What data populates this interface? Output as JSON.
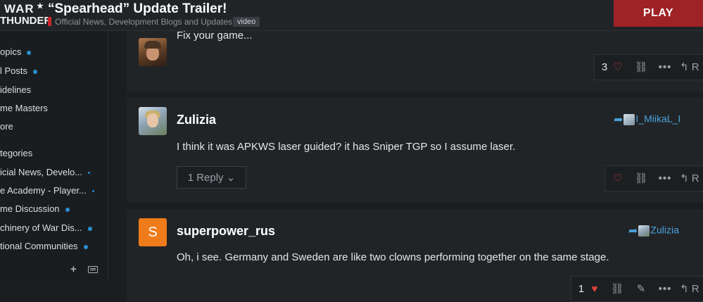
{
  "header": {
    "logo_line1": "WAR",
    "logo_line2": "THUNDER",
    "topic_title": "“Spearhead” Update Trailer!",
    "category": "Official News, Development Blogs and Updates",
    "tag": "video",
    "play_label": "PLAY"
  },
  "sidebar": {
    "items": [
      {
        "label": "opics",
        "dot": true
      },
      {
        "label": "l Posts",
        "dot": true
      },
      {
        "label": "idelines",
        "dot": false
      },
      {
        "label": "me Masters",
        "dot": false
      },
      {
        "label": "ore",
        "dot": false
      },
      {
        "label": "tegories",
        "dot": false
      },
      {
        "label": "icial News, Develo...",
        "dot": "small"
      },
      {
        "label": "e Academy - Player...",
        "dot": "small"
      },
      {
        "label": "me Discussion",
        "dot": true
      },
      {
        "label": "chinery of War Dis...",
        "dot": true
      },
      {
        "label": "tional Communities",
        "dot": true
      }
    ],
    "accent_color": "#2a8fd1"
  },
  "posts": [
    {
      "body": "Fix your game...",
      "likes": "3",
      "actions": [
        "heart-icon",
        "link-icon",
        "more-icon",
        "reply-icon"
      ],
      "reply_label": "R"
    },
    {
      "username": "Zulizia",
      "reply_to": "I_MiikaL_I",
      "body": "I think it was APKWS laser guided? it has Sniper TGP so I assume laser.",
      "replies_button": "1 Reply",
      "actions": [
        "heart-icon",
        "link-icon",
        "more-icon",
        "reply-icon"
      ],
      "reply_label": "R"
    },
    {
      "username": "superpower_rus",
      "avatar_letter": "S",
      "avatar_color": "#ef7b1a",
      "reply_to": "Zulizia",
      "body": "Oh, i see. Germany and Sweden are like two clowns performing together on the same stage.",
      "likes": "1",
      "actions": [
        "heart-filled-icon",
        "link-icon",
        "edit-icon",
        "more-icon",
        "reply-icon"
      ],
      "reply_label": "R"
    }
  ]
}
